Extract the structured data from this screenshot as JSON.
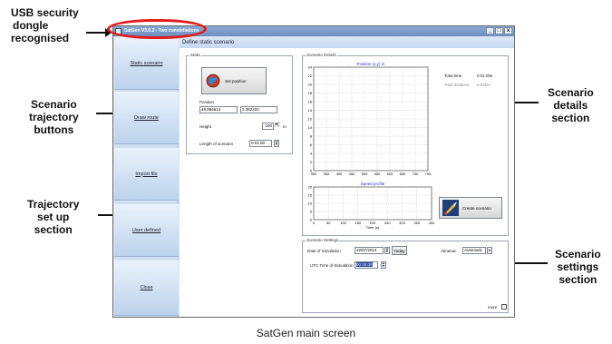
{
  "annotations": {
    "usb_line1": "USB security",
    "usb_line2": "dongle",
    "usb_line3": "recognised",
    "traj_btn_line1": "Scenario",
    "traj_btn_line2": "trajectory",
    "traj_btn_line3": "buttons",
    "traj_setup_line1": "Trajectory",
    "traj_setup_line2": "set up",
    "traj_setup_line3": "section",
    "details_line1": "Scenario",
    "details_line2": "details",
    "details_line3": "section",
    "settings_line1": "Scenario",
    "settings_line2": "settings",
    "settings_line3": "section"
  },
  "caption": "SatGen main screen",
  "window": {
    "title": "SatGen V3.0.2 - Two constellations",
    "controls": [
      "_",
      "□",
      "x"
    ]
  },
  "sidebar": {
    "items": [
      {
        "label": "Static scenario"
      },
      {
        "label": "Draw route"
      },
      {
        "label": "Import file"
      },
      {
        "label": "User defined"
      },
      {
        "label": "Close"
      }
    ]
  },
  "main": {
    "title": "Define static scenario"
  },
  "static_panel": {
    "group_label": "Static",
    "set_position_label": "Set position",
    "position_label": "Position",
    "latitude": "48.856614",
    "longitude": "2.352222",
    "height_label": "Height",
    "height_value": "100",
    "height_unit": "m",
    "length_label": "Length of scenario",
    "length_value": "0:01:00"
  },
  "details_panel": {
    "group_label": "Scenario Details",
    "total_time_label": "Total time",
    "total_time_value": "0:01:00s",
    "total_distance_label": "Total distance",
    "total_distance_value": "0.00km",
    "create_scenario_label": "Create scenario"
  },
  "settings_panel": {
    "group_label": "Scenario Settings",
    "date_label": "Date of Simulation",
    "date_value": "22/07/2014",
    "today_label": "Today",
    "almanac_label": "Almanac",
    "almanac_value": "Automatic",
    "utc_label": "UTC Time of Simulation",
    "utc_value": "00:00:00",
    "more_label": "more"
  },
  "chart_data": [
    {
      "type": "scatter",
      "title": "Position (x,y) m",
      "xlabel": "",
      "ylabel": "",
      "xlim": [
        300,
        750
      ],
      "ylim": [
        0,
        24
      ],
      "xticks": [
        300,
        350,
        400,
        450,
        500,
        550,
        600,
        650,
        700,
        750
      ],
      "yticks": [
        0,
        2,
        4,
        6,
        8,
        10,
        12,
        14,
        16,
        18,
        20,
        22,
        24
      ],
      "grid": true,
      "series": []
    },
    {
      "type": "line",
      "title": "Speed profile",
      "xlabel": "Time (s)",
      "ylabel": "",
      "xlim": [
        0,
        400
      ],
      "ylim": [
        0,
        20
      ],
      "xticks": [
        0,
        50,
        100,
        150,
        200,
        250,
        300,
        350,
        400
      ],
      "yticks": [
        0,
        5,
        10,
        15,
        20
      ],
      "grid": true,
      "series": []
    }
  ],
  "colors": {
    "highlight_ring": "#e21b1b",
    "plot_title": "#2b2bd0",
    "sidebar_bg": "#cfe0f3"
  }
}
